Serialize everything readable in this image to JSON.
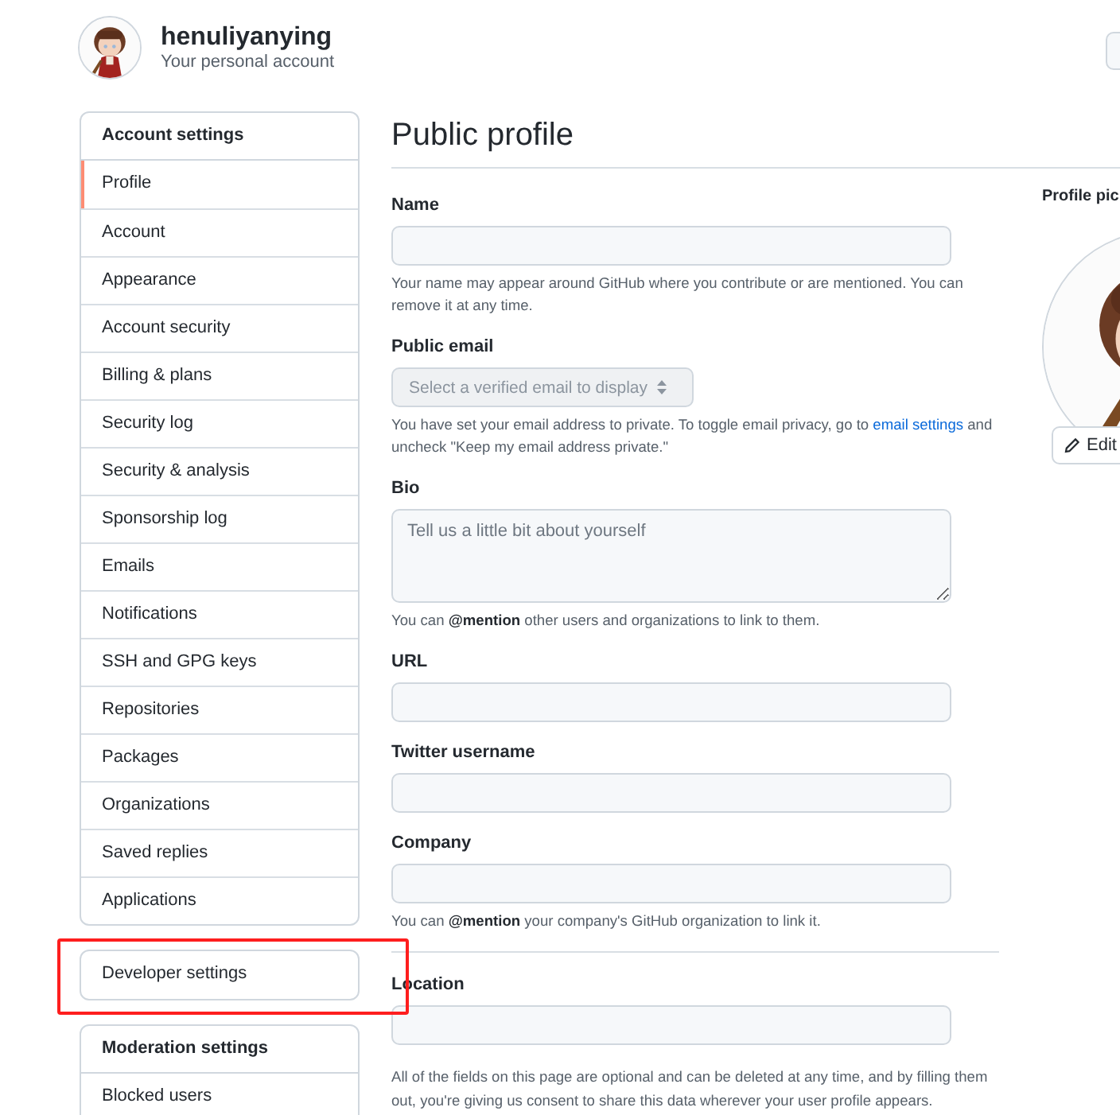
{
  "account": {
    "name": "henuliyanying",
    "subtitle": "Your personal account"
  },
  "sidebar": [
    {
      "title": "Account settings",
      "highlighted": false,
      "items": [
        {
          "label": "Profile",
          "selected": true
        },
        {
          "label": "Account",
          "selected": false
        },
        {
          "label": "Appearance",
          "selected": false
        },
        {
          "label": "Account security",
          "selected": false
        },
        {
          "label": "Billing & plans",
          "selected": false
        },
        {
          "label": "Security log",
          "selected": false
        },
        {
          "label": "Security & analysis",
          "selected": false
        },
        {
          "label": "Sponsorship log",
          "selected": false
        },
        {
          "label": "Emails",
          "selected": false
        },
        {
          "label": "Notifications",
          "selected": false
        },
        {
          "label": "SSH and GPG keys",
          "selected": false
        },
        {
          "label": "Repositories",
          "selected": false
        },
        {
          "label": "Packages",
          "selected": false
        },
        {
          "label": "Organizations",
          "selected": false
        },
        {
          "label": "Saved replies",
          "selected": false
        },
        {
          "label": "Applications",
          "selected": false
        }
      ]
    },
    {
      "highlighted": true,
      "items": [
        {
          "label": "Developer settings",
          "selected": false
        }
      ]
    },
    {
      "title": "Moderation settings",
      "highlighted": false,
      "items": [
        {
          "label": "Blocked users",
          "selected": false
        }
      ]
    }
  ],
  "page_title": "Public profile",
  "fields": [
    {
      "kind": "text",
      "label": "Name",
      "help": "Your name may appear around GitHub where you contribute or are mentioned. You can remove it at any time."
    },
    {
      "kind": "select",
      "label": "Public email",
      "placeholder": "Select a verified email to display",
      "help": "You have set your email address to private. To toggle email privacy, go to ",
      "help_link": "email settings",
      "help_after": " and uncheck \"Keep my email address private.\""
    },
    {
      "kind": "textarea",
      "label": "Bio",
      "placeholder": "Tell us a little bit about yourself",
      "help": "You can **@mention** other users and organizations to link to them."
    },
    {
      "kind": "text",
      "label": "URL"
    },
    {
      "kind": "text",
      "label": "Twitter username"
    },
    {
      "kind": "text",
      "label": "Company",
      "help": "You can **@mention** your company's GitHub organization to link it."
    },
    {
      "kind": "text",
      "label": "Location",
      "divider_before": true
    }
  ],
  "footer_note": "All of the fields on this page are optional and can be deleted at any time, and by filling them out, you're giving us consent to share this data wherever your user profile appears.",
  "profile_picture": {
    "label": "Profile pic",
    "edit_button": "Edit"
  }
}
